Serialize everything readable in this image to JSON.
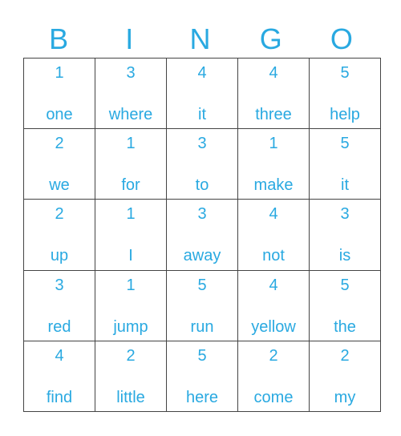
{
  "header": {
    "letters": [
      "B",
      "I",
      "N",
      "G",
      "O"
    ]
  },
  "theme": {
    "text_color": "#29a9e1",
    "border_color": "#444444"
  },
  "grid": {
    "rows": [
      [
        {
          "num": "1",
          "word": "one"
        },
        {
          "num": "3",
          "word": "where"
        },
        {
          "num": "4",
          "word": "it"
        },
        {
          "num": "4",
          "word": "three"
        },
        {
          "num": "5",
          "word": "help"
        }
      ],
      [
        {
          "num": "2",
          "word": "we"
        },
        {
          "num": "1",
          "word": "for"
        },
        {
          "num": "3",
          "word": "to"
        },
        {
          "num": "1",
          "word": "make"
        },
        {
          "num": "5",
          "word": "it"
        }
      ],
      [
        {
          "num": "2",
          "word": "up"
        },
        {
          "num": "1",
          "word": "I"
        },
        {
          "num": "3",
          "word": "away"
        },
        {
          "num": "4",
          "word": "not"
        },
        {
          "num": "3",
          "word": "is"
        }
      ],
      [
        {
          "num": "3",
          "word": "red"
        },
        {
          "num": "1",
          "word": "jump"
        },
        {
          "num": "5",
          "word": "run"
        },
        {
          "num": "4",
          "word": "yellow"
        },
        {
          "num": "5",
          "word": "the"
        }
      ],
      [
        {
          "num": "4",
          "word": "find"
        },
        {
          "num": "2",
          "word": "little"
        },
        {
          "num": "5",
          "word": "here"
        },
        {
          "num": "2",
          "word": "come"
        },
        {
          "num": "2",
          "word": "my"
        }
      ]
    ]
  }
}
